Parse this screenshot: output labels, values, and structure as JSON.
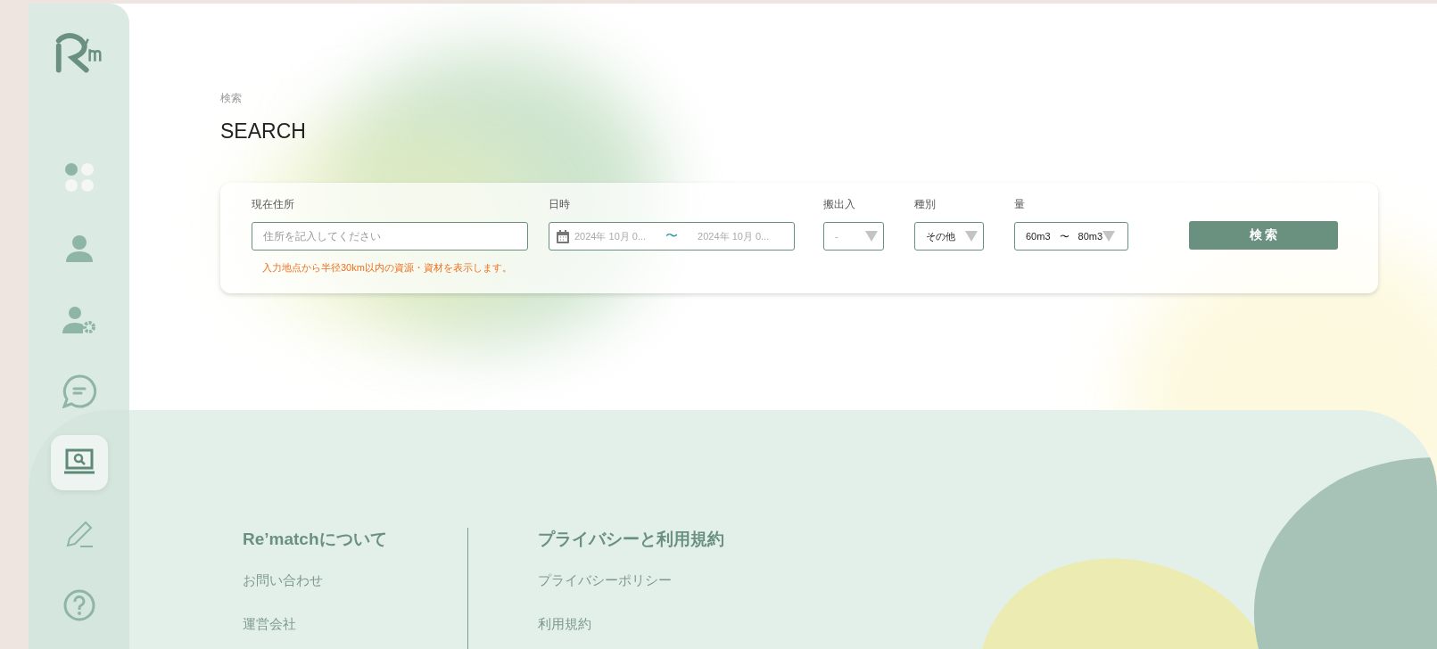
{
  "sidebar": {
    "items": [
      {
        "selected": false
      },
      {
        "selected": false
      },
      {
        "selected": false
      },
      {
        "selected": false
      },
      {
        "selected": true
      },
      {
        "selected": false
      },
      {
        "selected": false
      }
    ]
  },
  "page": {
    "subtitle": "検索",
    "title": "SEARCH"
  },
  "search_form": {
    "address": {
      "label": "現在住所",
      "placeholder": "住所を記入してください",
      "note": "入力地点から半径30km以内の資源・資材を表示します。"
    },
    "date": {
      "label": "日時",
      "start": "2024年 10月 0...",
      "separator": "〜",
      "end": "2024年 10月 0..."
    },
    "direction": {
      "label": "搬出入",
      "value": "-"
    },
    "category": {
      "label": "種別",
      "value": "その他"
    },
    "amount": {
      "label": "量",
      "from": "60m3",
      "separator": "〜",
      "to": "80m3"
    },
    "submit": "検 索"
  },
  "footer": {
    "columns": [
      {
        "heading": "Re’matchについて",
        "links": [
          "お問い合わせ",
          "運営会社"
        ]
      },
      {
        "heading": "プライバシーと利用規約",
        "links": [
          "プライバシーポリシー",
          "利用規約"
        ]
      }
    ]
  }
}
